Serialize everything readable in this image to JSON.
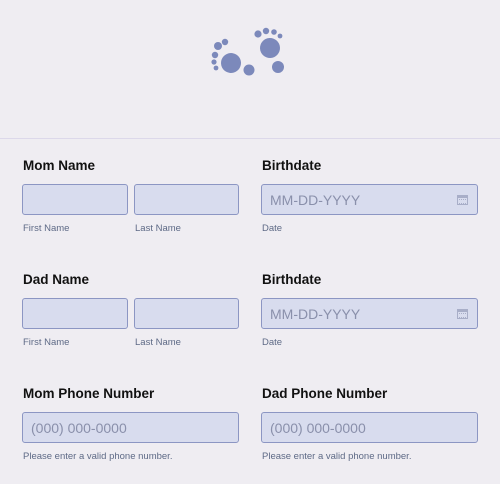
{
  "header": {
    "logo_icon": "baby-footprints-icon",
    "accent_color": "#7c89bb"
  },
  "sections": [
    {
      "name_label": "Mom Name",
      "first_sub": "First Name",
      "last_sub": "Last Name",
      "date_label": "Birthdate",
      "date_placeholder": "MM-DD-YYYY",
      "date_sub": "Date"
    },
    {
      "name_label": "Dad Name",
      "first_sub": "First Name",
      "last_sub": "Last Name",
      "date_label": "Birthdate",
      "date_placeholder": "MM-DD-YYYY",
      "date_sub": "Date"
    }
  ],
  "phones": {
    "mom_label": "Mom Phone Number",
    "mom_placeholder": "(000) 000-0000",
    "mom_sub": "Please enter a valid phone number.",
    "dad_label": "Dad Phone Number",
    "dad_placeholder": "(000) 000-0000",
    "dad_sub": "Please enter a valid phone number."
  }
}
